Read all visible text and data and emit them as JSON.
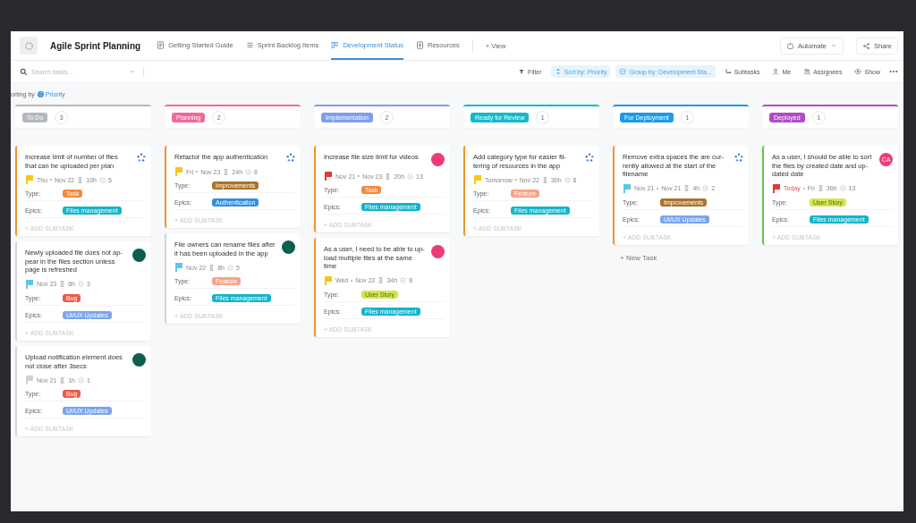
{
  "header": {
    "title": "Agile Sprint Planning",
    "tabs": [
      {
        "label": "Getting Started Guide",
        "kind": "doc",
        "selected": false
      },
      {
        "label": "Sprint Backlog Items",
        "kind": "list",
        "selected": false
      },
      {
        "label": "Development Status",
        "kind": "board",
        "selected": true
      },
      {
        "label": "Resources",
        "kind": "doc",
        "selected": false
      }
    ],
    "add_view": "+ View",
    "automate": "Automate",
    "share": "Share"
  },
  "toolbar": {
    "search": {
      "placeholder": "Search tasks..."
    },
    "items": [
      {
        "label": "Filter",
        "kind": "filter",
        "selected": false
      },
      {
        "label": "Sort by: Priority",
        "kind": "sort",
        "selected": true
      },
      {
        "label": "Group by: Development Sta...",
        "kind": "group",
        "selected": true
      },
      {
        "label": "Subtasks",
        "kind": "subtasks",
        "selected": false
      },
      {
        "label": "Me",
        "kind": "me",
        "selected": false
      },
      {
        "label": "Assignees",
        "kind": "assignees",
        "selected": false
      },
      {
        "label": "Show",
        "kind": "show",
        "selected": false
      }
    ]
  },
  "sorting": {
    "label": "orting by",
    "value": "Priority"
  },
  "columns": [
    {
      "name": "To Do",
      "count": "3",
      "color": "#b4b8bf",
      "cards": [
        {
          "title_lines": [
            "Increase limit of number of files",
            "that can be uploaded per plan"
          ],
          "color": "#f0932b",
          "flag": {
            "color": "#f6c517"
          },
          "dates": [
            "Thu",
            "Nov 22"
          ],
          "late": false,
          "estimate": "10h",
          "subtasks": "5",
          "avatar": {
            "kind": "team"
          },
          "fields": [
            {
              "label": "Type:",
              "value": "Task",
              "color": "#f5883a"
            },
            {
              "label": "Epics:",
              "value": "Files management",
              "color": "#12b5cb"
            }
          ],
          "add_subtask": "+ ADD SUBTASK"
        },
        {
          "title_lines": [
            "Newly uploaded file does not ap-",
            "pear in the files section unless",
            "page is refreshed"
          ],
          "color": "#d3d5da",
          "flag": {
            "color": "#5bc8e8"
          },
          "dates": [
            "Nov 23"
          ],
          "late": false,
          "estimate": "6h",
          "subtasks": "3",
          "avatar": {
            "kind": "person",
            "color": "#0f5e4d"
          },
          "fields": [
            {
              "label": "Type:",
              "value": "Bug",
              "color": "#ef5a45"
            },
            {
              "label": "Epics:",
              "value": "UI/UX Updates",
              "color": "#78a5f2"
            }
          ],
          "add_subtask": "+ ADD SUBTASK"
        },
        {
          "title_lines": [
            "Upload notification element does",
            "not close after 3secs"
          ],
          "color": "#d3d5da",
          "flag": {
            "color": "#cfd2d6"
          },
          "dates": [
            "Nov 21"
          ],
          "late": false,
          "estimate": "1h",
          "subtasks": "1",
          "avatar": {
            "kind": "person",
            "color": "#0f5e4d"
          },
          "fields": [
            {
              "label": "Type:",
              "value": "Bug",
              "color": "#ef5a45"
            },
            {
              "label": "Epics:",
              "value": "UI/UX Updates",
              "color": "#78a5f2"
            }
          ],
          "add_subtask": "+ ADD SUBTASK"
        }
      ]
    },
    {
      "name": "Planning",
      "count": "2",
      "color": "#f2679a",
      "cards": [
        {
          "title_lines": [
            "Refactor the app authentication"
          ],
          "color": "#f0932b",
          "flag": {
            "color": "#f6c517"
          },
          "dates": [
            "Fri",
            "Nov 23"
          ],
          "late": false,
          "estimate": "24h",
          "subtasks": "8",
          "avatar": {
            "kind": "team"
          },
          "fields": [
            {
              "label": "Type:",
              "value": "Improvements",
              "color": "#a8732b"
            },
            {
              "label": "Epics:",
              "value": "Authentication",
              "color": "#2f8fe0"
            }
          ],
          "add_subtask": "+ ADD SUBTASK"
        },
        {
          "title_lines": [
            "File owners can rename files after",
            "it has been uploaded in the app"
          ],
          "color": "#d3d5da",
          "flag": {
            "color": "#5bc8e8"
          },
          "dates": [
            "Nov 22"
          ],
          "late": false,
          "estimate": "8h",
          "subtasks": "5",
          "avatar": {
            "kind": "person",
            "color": "#0f5e4d"
          },
          "fields": [
            {
              "label": "Type:",
              "value": "Feature",
              "color": "#f7a38a"
            },
            {
              "label": "Epics:",
              "value": "Files management",
              "color": "#12b5cb"
            }
          ],
          "add_subtask": "+ ADD SUBTASK"
        }
      ]
    },
    {
      "name": "Implementation",
      "count": "2",
      "color": "#7f9ef0",
      "cards": [
        {
          "title_lines": [
            "Increase file size limit for videos"
          ],
          "color": "#f0932b",
          "flag": {
            "color": "#e53935"
          },
          "dates": [
            "Nov 21",
            "Nov 23"
          ],
          "late": false,
          "estimate": "20h",
          "subtasks": "13",
          "avatar": {
            "kind": "person",
            "color": "#ee3a78"
          },
          "fields": [
            {
              "label": "Type:",
              "value": "Task",
              "color": "#f5883a"
            },
            {
              "label": "Epics:",
              "value": "Files management",
              "color": "#12b5cb"
            }
          ],
          "add_subtask": "+ ADD SUBTASK"
        },
        {
          "title_lines": [
            "As a user, I need to be able to up-",
            "load multiple files at the same",
            "time"
          ],
          "color": "#f0932b",
          "flag": {
            "color": "#f6c517"
          },
          "dates": [
            "Wed",
            "Nov 22"
          ],
          "late": false,
          "estimate": "34h",
          "subtasks": "8",
          "avatar": {
            "kind": "person",
            "color": "#ee3a78"
          },
          "fields": [
            {
              "label": "Type:",
              "value": "User Story",
              "color": "#d4e84c"
            },
            {
              "label": "Epics:",
              "value": "Files management",
              "color": "#12b5cb"
            }
          ],
          "add_subtask": "+ ADD SUBTASK"
        }
      ]
    },
    {
      "name": "Ready for Review",
      "count": "1",
      "color": "#14b9c9",
      "cards": [
        {
          "title_lines": [
            "Add category type for easier fil-",
            "tering of resources in the app"
          ],
          "color": "#f0932b",
          "flag": {
            "color": "#f6c517"
          },
          "dates": [
            "Tomorrow",
            "Nov 22"
          ],
          "late": false,
          "estimate": "30h",
          "subtasks": "8",
          "avatar": {
            "kind": "team"
          },
          "fields": [
            {
              "label": "Type:",
              "value": "Feature",
              "color": "#f7a38a"
            },
            {
              "label": "Epics:",
              "value": "Files management",
              "color": "#12b5cb"
            }
          ],
          "add_subtask": "+ ADD SUBTASK"
        }
      ]
    },
    {
      "name": "For Deployment",
      "count": "1",
      "color": "#1a9be6",
      "new_task": "+ New Task",
      "cards": [
        {
          "title_lines": [
            "Remove extra spaces the are cur-",
            "rently allowed at the start of the",
            "filename"
          ],
          "color": "#f0932b",
          "flag": {
            "color": "#5bc8e8"
          },
          "dates": [
            "Nov 21",
            "Nov 21"
          ],
          "late": false,
          "estimate": "4h",
          "subtasks": "2",
          "avatar": {
            "kind": "team"
          },
          "fields": [
            {
              "label": "Type:",
              "value": "Improvements",
              "color": "#a8732b"
            },
            {
              "label": "Epics:",
              "value": "UI/UX Updates",
              "color": "#78a5f2"
            }
          ],
          "add_subtask": "+ ADD SUBTASK"
        }
      ]
    },
    {
      "name": "Deployed",
      "count": "1",
      "color": "#b24bc6",
      "cards": [
        {
          "title_lines": [
            "As a user, I should be able to sort",
            "the files by created date and up-",
            "dated date"
          ],
          "color": "#6cc04a",
          "flag": {
            "color": "#e53935"
          },
          "dates": [
            "Today",
            "Fri"
          ],
          "late": true,
          "estimate": "36h",
          "subtasks": "13",
          "avatar": {
            "kind": "person",
            "color": "#ee3a78",
            "initials": "CA"
          },
          "fields": [
            {
              "label": "Type:",
              "value": "User Story",
              "color": "#d4e84c"
            },
            {
              "label": "Epics:",
              "value": "Files management",
              "color": "#12b5cb"
            }
          ],
          "add_subtask": "+ ADD SUBTASK"
        }
      ]
    }
  ]
}
